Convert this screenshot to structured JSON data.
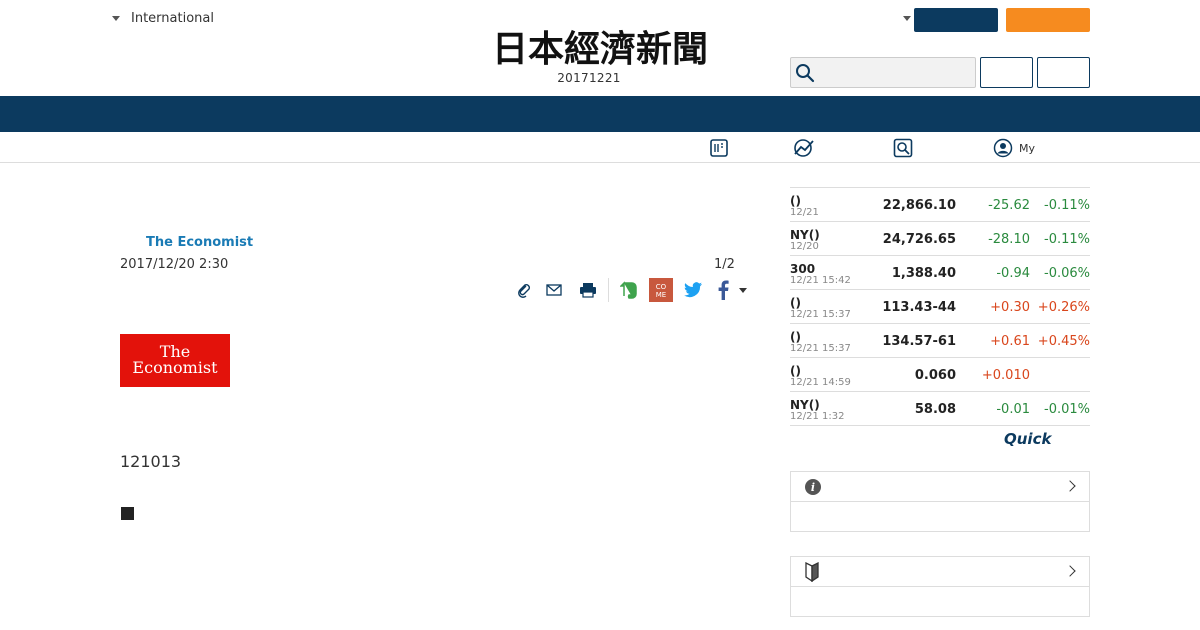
{
  "header": {
    "region_label": "International",
    "issue_date": "20171221",
    "logo_text": "日本經濟新聞",
    "search": {
      "value": "",
      "placeholder": ""
    }
  },
  "subnav": {
    "items": [
      {
        "icon": "newspaper-icon"
      },
      {
        "icon": "chart-icon"
      },
      {
        "icon": "search-icon"
      },
      {
        "icon": "user-icon",
        "label": "My"
      }
    ]
  },
  "article": {
    "source": "The Economist",
    "date": "2017/12/20 2:30",
    "page_count": "1/2",
    "logo_line1": "The",
    "logo_line2": "Economist",
    "body_text": "121013"
  },
  "tools": [
    "clip-icon",
    "mail-icon",
    "print-icon",
    "evernote-icon",
    "comment-icon",
    "twitter-icon",
    "facebook-icon"
  ],
  "market": {
    "rows": [
      {
        "name": "()",
        "time": "12/21",
        "value": "22,866.10",
        "change": "-25.62",
        "pct": "-0.11%",
        "dir": "neg"
      },
      {
        "name": "NY()",
        "time": "12/20",
        "value": "24,726.65",
        "change": "-28.10",
        "pct": "-0.11%",
        "dir": "neg"
      },
      {
        "name": "300",
        "time": "12/21 15:42",
        "value": "1,388.40",
        "change": "-0.94",
        "pct": "-0.06%",
        "dir": "neg"
      },
      {
        "name": "()",
        "time": "12/21 15:37",
        "value": "113.43-44",
        "change": "+0.30",
        "pct": "+0.26%",
        "dir": "pos"
      },
      {
        "name": "()",
        "time": "12/21 15:37",
        "value": "134.57-61",
        "change": "+0.61",
        "pct": "+0.45%",
        "dir": "pos"
      },
      {
        "name": "()",
        "time": "12/21 14:59",
        "value": "0.060",
        "change": "+0.010",
        "pct": "",
        "dir": "pos"
      },
      {
        "name": "NY()",
        "time": "12/21 1:32",
        "value": "58.08",
        "change": "-0.01",
        "pct": "-0.01%",
        "dir": "neg"
      }
    ],
    "provider": "Quick"
  },
  "colors": {
    "navy": "#0c3a5f",
    "orange": "#f68b1f",
    "link_blue": "#1a7bb5",
    "down_green": "#2a8a3e",
    "up_red": "#d9461c",
    "economist_red": "#e3120b"
  }
}
